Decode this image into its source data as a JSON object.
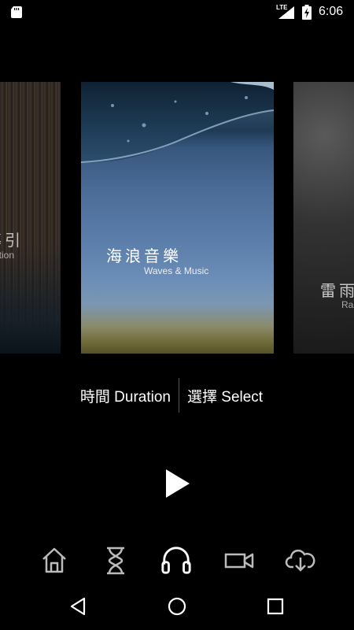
{
  "status_bar": {
    "network": "LTE",
    "time": "6:06"
  },
  "cards": [
    {
      "title": "冥想導引",
      "subtitle": "Meditation",
      "visible_title": "導引",
      "visible_subtitle": "ation"
    },
    {
      "title": "海浪音樂",
      "subtitle": "Waves & Music"
    },
    {
      "title": "雷雨",
      "subtitle": "Ra"
    }
  ],
  "selector": {
    "duration_label": "時間 Duration",
    "select_label": "選擇 Select"
  },
  "bottom_nav": [
    "home-icon",
    "hourglass-icon",
    "headphones-icon",
    "video-camera-icon",
    "cloud-download-icon"
  ],
  "system_nav": [
    "back-icon",
    "home-circle-icon",
    "recents-icon"
  ]
}
